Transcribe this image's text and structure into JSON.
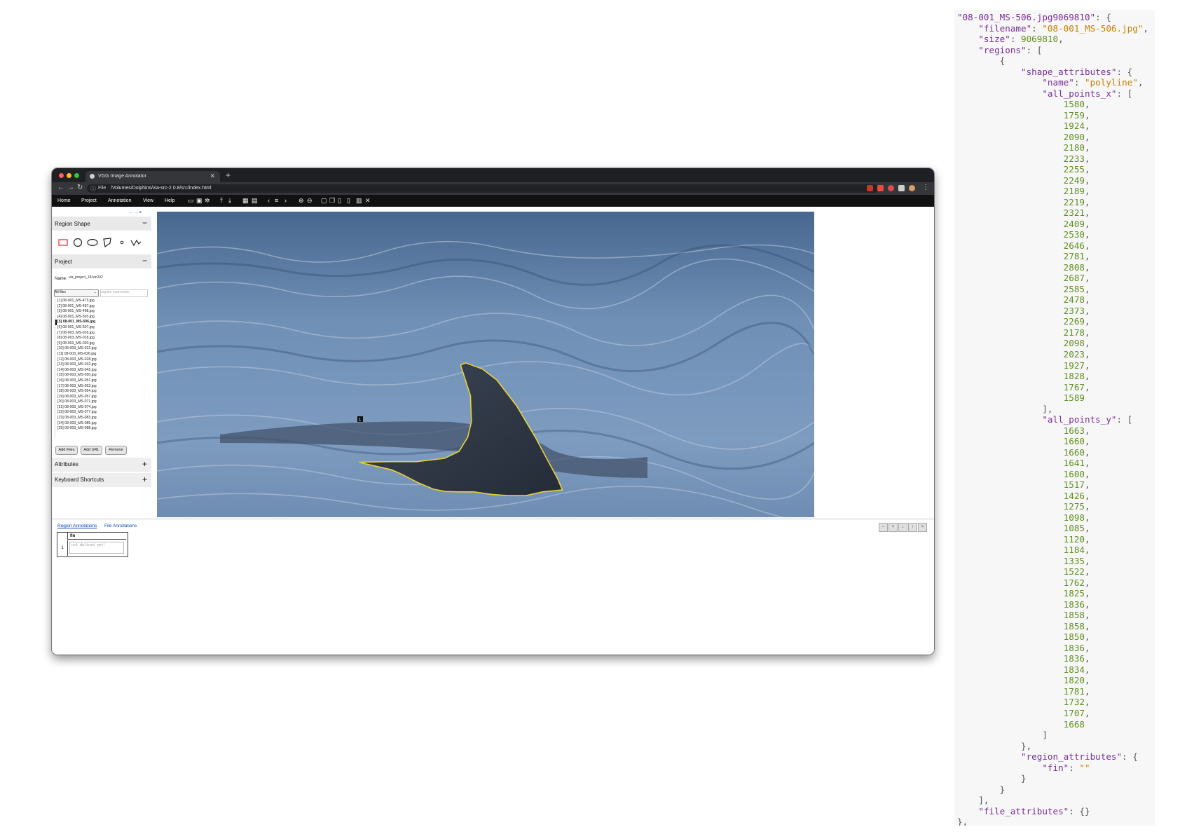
{
  "browser": {
    "tab_title": "VGG Image Annotator",
    "url_prefix": "File",
    "url": "/Volumes/Dolphins/via-src-2.0.8/src/index.html"
  },
  "menu": [
    "Home",
    "Project",
    "Annotation",
    "View",
    "Help"
  ],
  "toolbar_icons": [
    "open-icon",
    "save-icon",
    "settings-icon",
    "upload-icon",
    "download-icon",
    "grid-icon",
    "comment-icon",
    "prev-icon",
    "list-icon",
    "next-icon",
    "zoom-in-icon",
    "zoom-out-icon",
    "select-all-icon",
    "copy-icon",
    "paste-icon",
    "paste-n-icon",
    "delete-icon",
    "close-icon"
  ],
  "left_panel": {
    "region_shape_title": "Region Shape",
    "project_title": "Project",
    "name_label": "Name:",
    "project_name": "via_project_18Jan202",
    "filter_select": "All files",
    "filter_placeholder": "regular expression",
    "files": [
      "[1] 08-001_MS-473.jpg",
      "[2] 08-001_MS-487.jpg",
      "[3] 08-001_MS-498.jpg",
      "[4] 08-001_MS-503.jpg",
      "[5] 08-001_MS-506.jpg",
      "[6] 08-001_MS-507.jpg",
      "[7] 08-003_MS-016.jpg",
      "[8] 08-003_MS-018.jpg",
      "[9] 08-003_MS-020.jpg",
      "[10] 08-003_MS-022.jpg",
      "[11] 08-003_MS-026.jpg",
      "[12] 08-003_MS-028.jpg",
      "[13] 08-003_MS-032.jpg",
      "[14] 08-003_MS-042.jpg",
      "[15] 08-003_MS-050.jpg",
      "[16] 08-003_MS-051.jpg",
      "[17] 08-003_MS-053.jpg",
      "[18] 08-003_MS-054.jpg",
      "[19] 08-003_MS-057.jpg",
      "[20] 08-003_MS-071.jpg",
      "[21] 08-003_MS-074.jpg",
      "[22] 08-003_MS-077.jpg",
      "[23] 08-003_MS-083.jpg",
      "[24] 08-003_MS-085.jpg",
      "[25] 08-003_MS-088.jpg"
    ],
    "current_file_index": 4,
    "add_files": "Add Files",
    "add_url": "Add URL",
    "remove": "Remove",
    "attributes_title": "Attributes",
    "shortcuts_title": "Keyboard Shortcuts"
  },
  "canvas": {
    "region_id": "1"
  },
  "bottom": {
    "tab_region": "Region Annotations",
    "tab_file": "File Annotations",
    "column": "fin",
    "row_num": "1",
    "cell_placeholder": "not defined yet!"
  },
  "json_panel": {
    "key": "08-001_MS-506.jpg9069810",
    "filename": "08-001_MS-506.jpg",
    "size": 9069810,
    "shape_name": "polyline",
    "all_points_x": [
      1580,
      1759,
      1924,
      2090,
      2180,
      2233,
      2255,
      2249,
      2189,
      2219,
      2321,
      2409,
      2530,
      2646,
      2781,
      2808,
      2687,
      2585,
      2478,
      2373,
      2269,
      2178,
      2098,
      2023,
      1927,
      1828,
      1767,
      1589
    ],
    "all_points_y": [
      1663,
      1660,
      1660,
      1641,
      1600,
      1517,
      1426,
      1275,
      1098,
      1085,
      1120,
      1184,
      1335,
      1522,
      1762,
      1825,
      1836,
      1858,
      1858,
      1850,
      1836,
      1836,
      1834,
      1820,
      1781,
      1732,
      1707,
      1668
    ],
    "region_attr_key": "fin",
    "region_attr_value": ""
  }
}
